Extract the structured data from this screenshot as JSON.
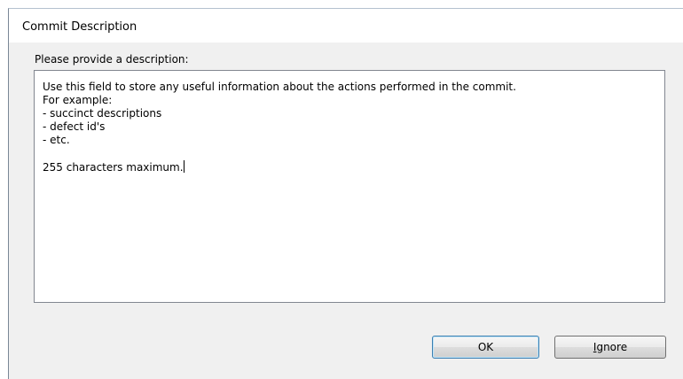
{
  "dialog": {
    "title": "Commit Description",
    "prompt_label": "Please provide a description:",
    "description_lines": [
      "Use this field to store any useful information about the actions performed in the commit.",
      "For example:",
      "- succinct descriptions",
      "- defect id's",
      "- etc.",
      "",
      "255 characters maximum."
    ],
    "buttons": {
      "ok_label": "OK",
      "ignore_label": "Ignore",
      "ignore_mnemonic": "I",
      "ignore_rest": "gnore"
    }
  }
}
